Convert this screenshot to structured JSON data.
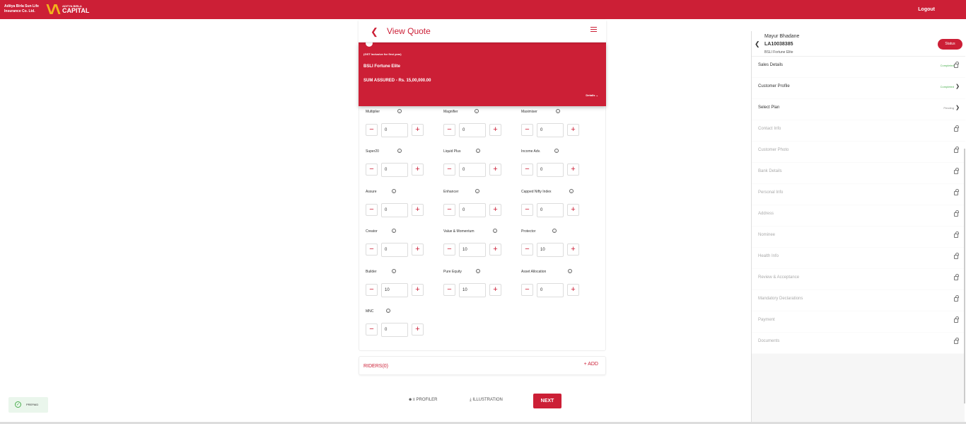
{
  "topbar": {
    "brand_primary": "Aditya Birla Sun Life Insurance Co. Ltd.",
    "brand_secondary_top": "ADITYA BIRLA",
    "brand_secondary_main": "CAPITAL",
    "logout": "Logout",
    "bg_color": "#cc1f36"
  },
  "quote": {
    "back_icon": "chevron-left-icon",
    "title": "View Quote",
    "menu_icon": "hamburger-menu-icon",
    "gst_note": "(GST Inclusive for first year)",
    "plan_name": "BSLI Fortune Elite",
    "sum_assured": "SUM ASSURED - Rs. 15,00,000.00",
    "details_label": "Details"
  },
  "funds": [
    {
      "name": "Multiplier",
      "value": "0"
    },
    {
      "name": "Magnifier",
      "value": "0"
    },
    {
      "name": "Maximiser",
      "value": "0"
    },
    {
      "name": "Super20",
      "value": "0"
    },
    {
      "name": "Liquid Plus",
      "value": "0"
    },
    {
      "name": "Income Adv.",
      "value": "0"
    },
    {
      "name": "Assure",
      "value": "0"
    },
    {
      "name": "Enhancer",
      "value": "0"
    },
    {
      "name": "Capped Nifty Index",
      "value": "0"
    },
    {
      "name": "Creator",
      "value": "0"
    },
    {
      "name": "Value & Momentum",
      "value": "10"
    },
    {
      "name": "Protector",
      "value": "10"
    },
    {
      "name": "Builder",
      "value": "10"
    },
    {
      "name": "Pure Equity",
      "value": "10"
    },
    {
      "name": "Asset Allocation",
      "value": "0"
    },
    {
      "name": "MNC",
      "value": "0"
    }
  ],
  "riders": {
    "label": "RIDERS(0)",
    "add_label": "+ ADD"
  },
  "actions": {
    "profiler": "PROFILER",
    "illustration": "ILLUSTRATION",
    "next": "NEXT"
  },
  "prepaid": {
    "label": "PREPAID"
  },
  "right_panel": {
    "customer_name": "Mayur Bhadane",
    "application_no": "LA10038385",
    "plan": "BSLI Fortune Elite",
    "status_label": "Status",
    "items": [
      {
        "label": "Sales Details",
        "state": "Completed",
        "type": "lock-done"
      },
      {
        "label": "Customer Profile",
        "state": "Completed",
        "type": "arrow"
      },
      {
        "label": "Select Plan",
        "state": "Pending",
        "type": "arrow"
      },
      {
        "label": "Contact Info",
        "state": "",
        "type": "locked"
      },
      {
        "label": "Customer Photo",
        "state": "",
        "type": "locked"
      },
      {
        "label": "Bank Details",
        "state": "",
        "type": "locked"
      },
      {
        "label": "Personal Info",
        "state": "",
        "type": "locked"
      },
      {
        "label": "Address",
        "state": "",
        "type": "locked"
      },
      {
        "label": "Nominee",
        "state": "",
        "type": "locked"
      },
      {
        "label": "Health Info",
        "state": "",
        "type": "locked"
      },
      {
        "label": "Review & Acceptance",
        "state": "",
        "type": "locked"
      },
      {
        "label": "Mandatory Declarations",
        "state": "",
        "type": "locked"
      },
      {
        "label": "Payment",
        "state": "",
        "type": "locked"
      },
      {
        "label": "Documents",
        "state": "",
        "type": "locked"
      }
    ]
  }
}
